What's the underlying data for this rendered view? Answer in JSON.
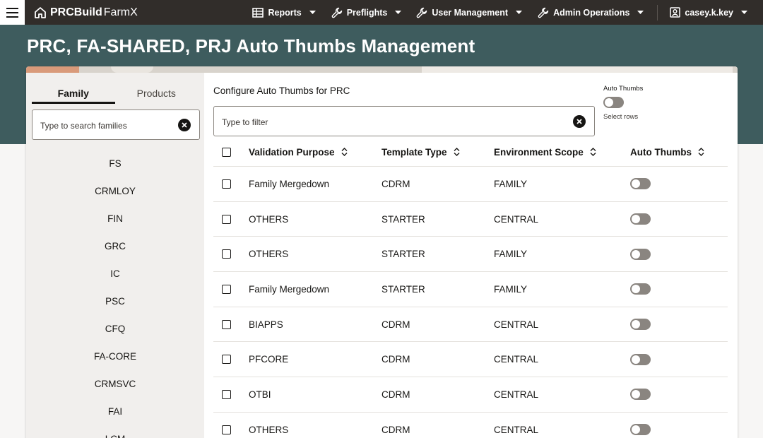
{
  "nav": {
    "brand_bold": "PRCBuild",
    "brand_light": "FarmX",
    "items": [
      {
        "label": "Reports"
      },
      {
        "label": "Preflights"
      },
      {
        "label": "User Management"
      },
      {
        "label": "Admin Operations"
      }
    ],
    "user": "casey.k.key"
  },
  "page": {
    "title": "PRC, FA-SHARED, PRJ Auto Thumbs Management"
  },
  "sidebar": {
    "tabs": [
      {
        "label": "Family",
        "active": true
      },
      {
        "label": "Products",
        "active": false
      }
    ],
    "search_placeholder": "Type to search families",
    "families": [
      "FS",
      "CRMLOY",
      "FIN",
      "GRC",
      "IC",
      "PSC",
      "CFQ",
      "FA-CORE",
      "CRMSVC",
      "FAI",
      "LCM"
    ]
  },
  "main": {
    "configure_label": "Configure Auto Thumbs for PRC",
    "toggle_label": "Auto Thumbs",
    "toggle_sub": "Select rows",
    "filter_placeholder": "Type to filter",
    "columns": [
      "Validation Purpose",
      "Template Type",
      "Environment Scope",
      "Auto Thumbs"
    ],
    "rows": [
      {
        "purpose": "Family Mergedown",
        "template": "CDRM",
        "scope": "FAMILY",
        "auto_thumbs": false
      },
      {
        "purpose": "OTHERS",
        "template": "STARTER",
        "scope": "CENTRAL",
        "auto_thumbs": false
      },
      {
        "purpose": "OTHERS",
        "template": "STARTER",
        "scope": "FAMILY",
        "auto_thumbs": false
      },
      {
        "purpose": "Family Mergedown",
        "template": "STARTER",
        "scope": "FAMILY",
        "auto_thumbs": false
      },
      {
        "purpose": "BIAPPS",
        "template": "CDRM",
        "scope": "CENTRAL",
        "auto_thumbs": false
      },
      {
        "purpose": "PFCORE",
        "template": "CDRM",
        "scope": "CENTRAL",
        "auto_thumbs": false
      },
      {
        "purpose": "OTBI",
        "template": "CDRM",
        "scope": "CENTRAL",
        "auto_thumbs": false
      },
      {
        "purpose": "OTHERS",
        "template": "CDRM",
        "scope": "CENTRAL",
        "auto_thumbs": false
      }
    ]
  },
  "colors": {
    "topbar": "#312d2a",
    "banner": "#3e5c5e",
    "sidebar_bg": "#f1efed",
    "toggle_off": "#8a8580"
  }
}
